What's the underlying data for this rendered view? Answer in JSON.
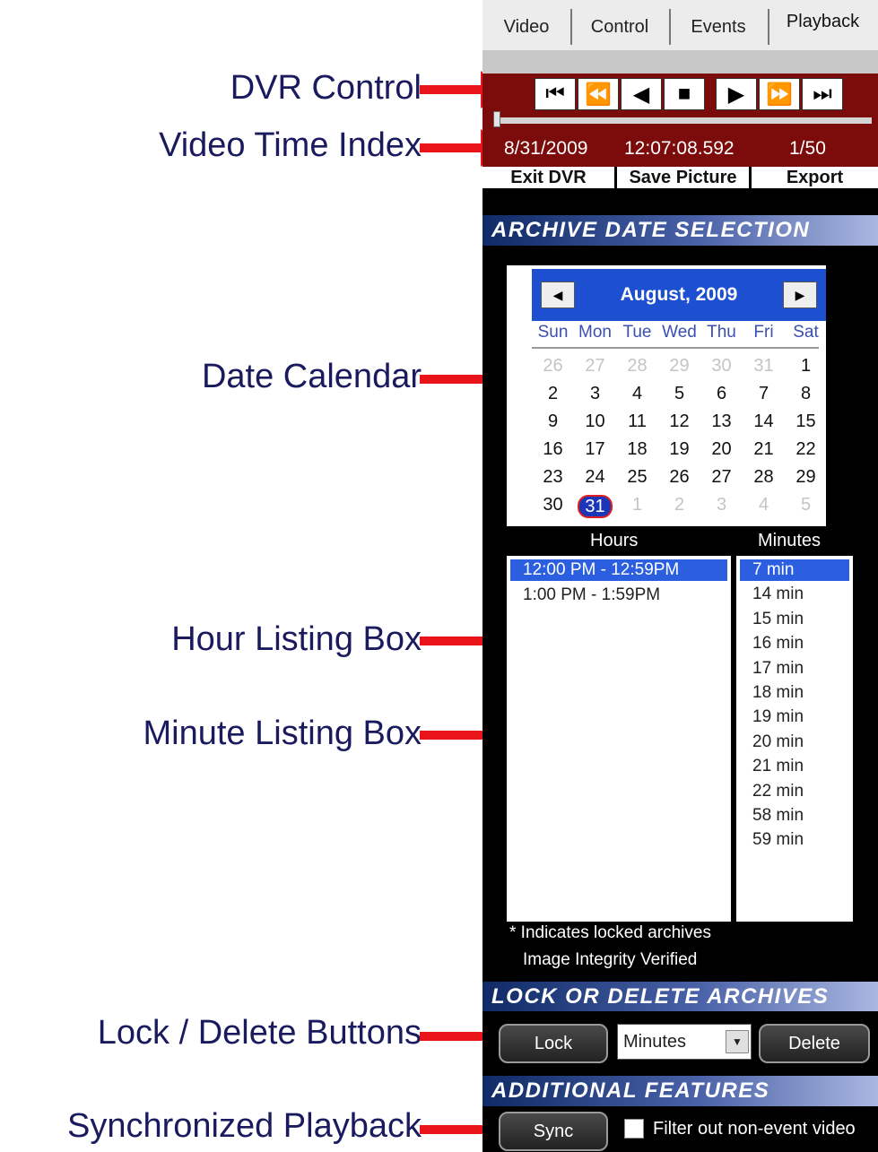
{
  "callouts": {
    "dvr_control": "DVR Control",
    "video_time_index": "Video Time Index",
    "date_calendar": "Date Calendar",
    "hour_listing_box": "Hour Listing Box",
    "minute_listing_box": "Minute  Listing Box",
    "lock_delete_buttons": "Lock / Delete Buttons",
    "synchronized_playback": "Synchronized Playback"
  },
  "tabs": [
    "Video",
    "Control",
    "Events",
    "Playback"
  ],
  "dvr": {
    "buttons": [
      "skip-to-start-icon",
      "rewind-icon",
      "play-reverse-icon",
      "stop-icon",
      "play-icon",
      "fast-forward-icon",
      "skip-to-end-icon"
    ],
    "date": "8/31/2009",
    "time": "12:07:08.592",
    "frame": "1/50",
    "exit_label": "Exit DVR",
    "save_label": "Save Picture",
    "export_label": "Export"
  },
  "archive_header": "ARCHIVE DATE SELECTION",
  "calendar": {
    "month": "August, 2009",
    "weekdays": [
      "Sun",
      "Mon",
      "Tue",
      "Wed",
      "Thu",
      "Fri",
      "Sat"
    ],
    "weeks": [
      [
        "26",
        "27",
        "28",
        "29",
        "30",
        "31",
        "1"
      ],
      [
        "2",
        "3",
        "4",
        "5",
        "6",
        "7",
        "8"
      ],
      [
        "9",
        "10",
        "11",
        "12",
        "13",
        "14",
        "15"
      ],
      [
        "16",
        "17",
        "18",
        "19",
        "20",
        "21",
        "22"
      ],
      [
        "23",
        "24",
        "25",
        "26",
        "27",
        "28",
        "29"
      ],
      [
        "30",
        "31",
        "1",
        "2",
        "3",
        "4",
        "5"
      ]
    ],
    "selected_day": "31"
  },
  "lists": {
    "hours_header": "Hours",
    "minutes_header": "Minutes",
    "hours": [
      "12:00 PM - 12:59PM",
      "1:00 PM - 1:59PM"
    ],
    "minutes": [
      "7 min",
      "14 min",
      "15 min",
      "16 min",
      "17 min",
      "18 min",
      "19 min",
      "20 min",
      "21 min",
      "22 min",
      "58 min",
      "59 min"
    ]
  },
  "notes": {
    "locked": "* Indicates locked archives",
    "integrity": "Image Integrity Verified"
  },
  "lock_header": "LOCK OR DELETE ARCHIVES",
  "lock": {
    "lock_label": "Lock",
    "unit_value": "Minutes",
    "delete_label": "Delete"
  },
  "features_header": "ADDITIONAL FEATURES",
  "features": {
    "sync_label": "Sync",
    "filter_label": "Filter out non-event video"
  },
  "colors": {
    "dvr_background": "#7c0c0c",
    "callout_text": "#1a1a5e",
    "arrow": "#e8141a",
    "selection_blue": "#2c5fe0"
  }
}
